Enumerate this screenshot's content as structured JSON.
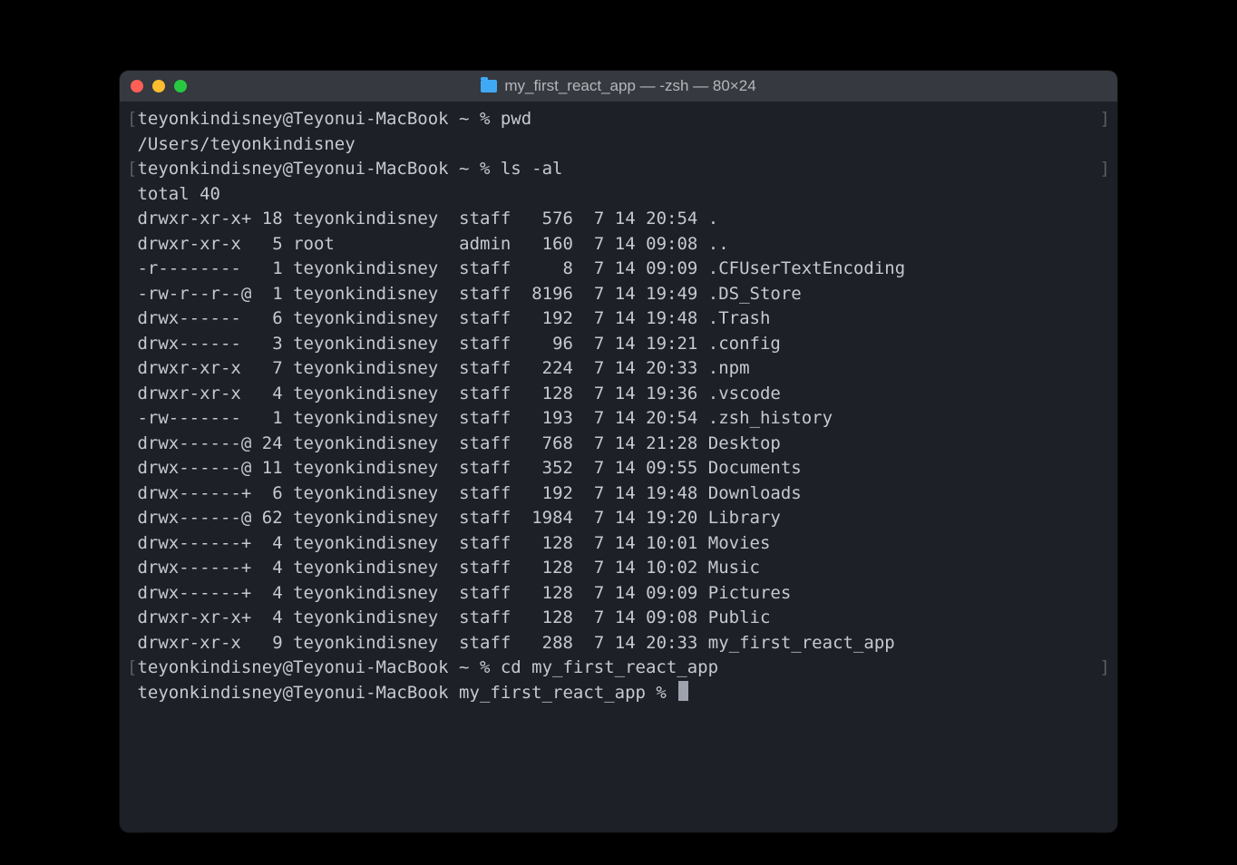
{
  "window": {
    "title": "my_first_react_app — -zsh — 80×24"
  },
  "prompts": [
    {
      "prefix": "teyonkindisney@Teyonui-MacBook ~ % ",
      "command": "pwd",
      "bracketed": true
    },
    {
      "prefix": "teyonkindisney@Teyonui-MacBook ~ % ",
      "command": "ls -al",
      "bracketed": true
    },
    {
      "prefix": "teyonkindisney@Teyonui-MacBook ~ % ",
      "command": "cd my_first_react_app",
      "bracketed": true
    },
    {
      "prefix": "teyonkindisney@Teyonui-MacBook my_first_react_app % ",
      "command": "",
      "bracketed": false
    }
  ],
  "pwd_output": "/Users/teyonkindisney",
  "ls": {
    "total_line": "total 40",
    "rows": [
      {
        "perm": "drwxr-xr-x+",
        "links": "18",
        "owner": "teyonkindisney",
        "group": "staff",
        "size": "576",
        "month": "7",
        "day": "14",
        "time": "20:54",
        "name": "."
      },
      {
        "perm": "drwxr-xr-x",
        "links": "5",
        "owner": "root",
        "group": "admin",
        "size": "160",
        "month": "7",
        "day": "14",
        "time": "09:08",
        "name": ".."
      },
      {
        "perm": "-r--------",
        "links": "1",
        "owner": "teyonkindisney",
        "group": "staff",
        "size": "8",
        "month": "7",
        "day": "14",
        "time": "09:09",
        "name": ".CFUserTextEncoding"
      },
      {
        "perm": "-rw-r--r--@",
        "links": "1",
        "owner": "teyonkindisney",
        "group": "staff",
        "size": "8196",
        "month": "7",
        "day": "14",
        "time": "19:49",
        "name": ".DS_Store"
      },
      {
        "perm": "drwx------",
        "links": "6",
        "owner": "teyonkindisney",
        "group": "staff",
        "size": "192",
        "month": "7",
        "day": "14",
        "time": "19:48",
        "name": ".Trash"
      },
      {
        "perm": "drwx------",
        "links": "3",
        "owner": "teyonkindisney",
        "group": "staff",
        "size": "96",
        "month": "7",
        "day": "14",
        "time": "19:21",
        "name": ".config"
      },
      {
        "perm": "drwxr-xr-x",
        "links": "7",
        "owner": "teyonkindisney",
        "group": "staff",
        "size": "224",
        "month": "7",
        "day": "14",
        "time": "20:33",
        "name": ".npm"
      },
      {
        "perm": "drwxr-xr-x",
        "links": "4",
        "owner": "teyonkindisney",
        "group": "staff",
        "size": "128",
        "month": "7",
        "day": "14",
        "time": "19:36",
        "name": ".vscode"
      },
      {
        "perm": "-rw-------",
        "links": "1",
        "owner": "teyonkindisney",
        "group": "staff",
        "size": "193",
        "month": "7",
        "day": "14",
        "time": "20:54",
        "name": ".zsh_history"
      },
      {
        "perm": "drwx------@",
        "links": "24",
        "owner": "teyonkindisney",
        "group": "staff",
        "size": "768",
        "month": "7",
        "day": "14",
        "time": "21:28",
        "name": "Desktop"
      },
      {
        "perm": "drwx------@",
        "links": "11",
        "owner": "teyonkindisney",
        "group": "staff",
        "size": "352",
        "month": "7",
        "day": "14",
        "time": "09:55",
        "name": "Documents"
      },
      {
        "perm": "drwx------+",
        "links": "6",
        "owner": "teyonkindisney",
        "group": "staff",
        "size": "192",
        "month": "7",
        "day": "14",
        "time": "19:48",
        "name": "Downloads"
      },
      {
        "perm": "drwx------@",
        "links": "62",
        "owner": "teyonkindisney",
        "group": "staff",
        "size": "1984",
        "month": "7",
        "day": "14",
        "time": "19:20",
        "name": "Library"
      },
      {
        "perm": "drwx------+",
        "links": "4",
        "owner": "teyonkindisney",
        "group": "staff",
        "size": "128",
        "month": "7",
        "day": "14",
        "time": "10:01",
        "name": "Movies"
      },
      {
        "perm": "drwx------+",
        "links": "4",
        "owner": "teyonkindisney",
        "group": "staff",
        "size": "128",
        "month": "7",
        "day": "14",
        "time": "10:02",
        "name": "Music"
      },
      {
        "perm": "drwx------+",
        "links": "4",
        "owner": "teyonkindisney",
        "group": "staff",
        "size": "128",
        "month": "7",
        "day": "14",
        "time": "09:09",
        "name": "Pictures"
      },
      {
        "perm": "drwxr-xr-x+",
        "links": "4",
        "owner": "teyonkindisney",
        "group": "staff",
        "size": "128",
        "month": "7",
        "day": "14",
        "time": "09:08",
        "name": "Public"
      },
      {
        "perm": "drwxr-xr-x",
        "links": "9",
        "owner": "teyonkindisney",
        "group": "staff",
        "size": "288",
        "month": "7",
        "day": "14",
        "time": "20:33",
        "name": "my_first_react_app"
      }
    ]
  }
}
